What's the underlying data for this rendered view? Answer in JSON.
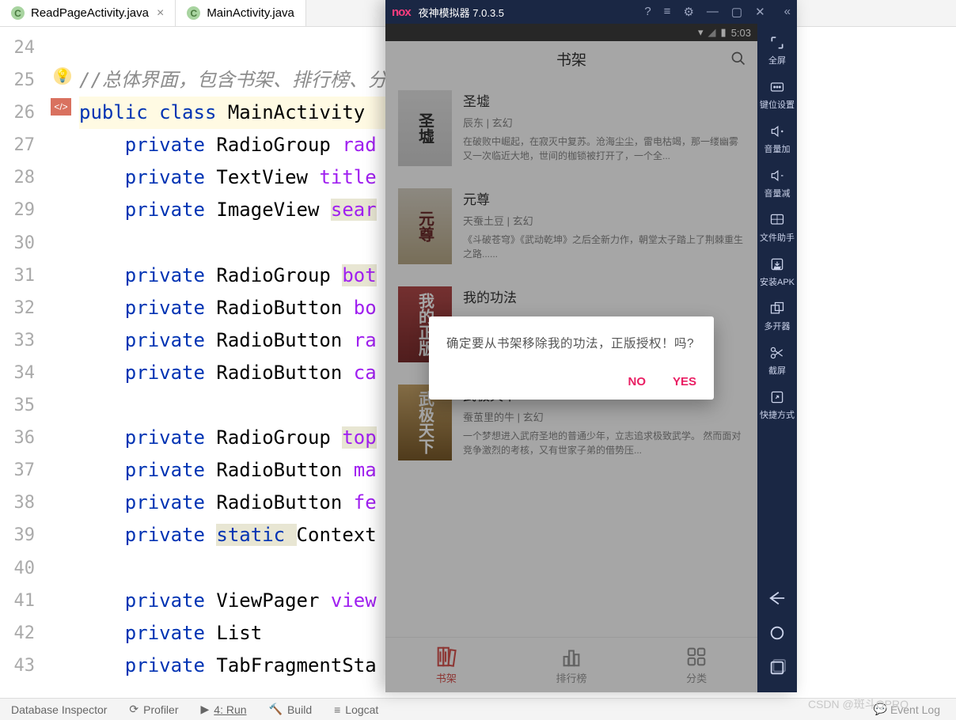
{
  "tabs": [
    {
      "label": "ReadPageActivity.java",
      "icon_letter": "C"
    },
    {
      "label": "MainActivity.java",
      "icon_letter": "C"
    }
  ],
  "gutter_lines": [
    "24",
    "25",
    "26",
    "27",
    "28",
    "29",
    "30",
    "31",
    "32",
    "33",
    "34",
    "35",
    "36",
    "37",
    "38",
    "39",
    "40",
    "41",
    "42",
    "43"
  ],
  "code_lines": [
    {
      "indent": 0,
      "tokens": []
    },
    {
      "indent": 0,
      "tokens": [
        {
          "t": "//",
          "cls": "cm"
        },
        {
          "t": "总体界面，包含书架、排行榜、分",
          "cls": "cm"
        }
      ]
    },
    {
      "indent": 0,
      "hl": true,
      "tokens": [
        {
          "t": "public ",
          "cls": "kw"
        },
        {
          "t": "class ",
          "cls": "kw"
        },
        {
          "t": "MainActivity ",
          "cls": "nm"
        }
      ]
    },
    {
      "indent": 1,
      "tokens": [
        {
          "t": "private ",
          "cls": "kw"
        },
        {
          "t": "RadioGroup ",
          "cls": "nm"
        },
        {
          "t": "rad",
          "cls": "fld"
        }
      ]
    },
    {
      "indent": 1,
      "tokens": [
        {
          "t": "private ",
          "cls": "kw"
        },
        {
          "t": "TextView ",
          "cls": "nm"
        },
        {
          "t": "title",
          "cls": "fld"
        }
      ]
    },
    {
      "indent": 1,
      "tokens": [
        {
          "t": "private ",
          "cls": "kw"
        },
        {
          "t": "ImageView ",
          "cls": "nm"
        },
        {
          "t": "sear",
          "cls": "fld hlw"
        }
      ]
    },
    {
      "indent": 0,
      "tokens": []
    },
    {
      "indent": 1,
      "tokens": [
        {
          "t": "private ",
          "cls": "kw"
        },
        {
          "t": "RadioGroup ",
          "cls": "nm"
        },
        {
          "t": "bot",
          "cls": "fld hlw"
        }
      ]
    },
    {
      "indent": 1,
      "tokens": [
        {
          "t": "private ",
          "cls": "kw"
        },
        {
          "t": "RadioButton ",
          "cls": "nm"
        },
        {
          "t": "bo",
          "cls": "fld"
        }
      ]
    },
    {
      "indent": 1,
      "tokens": [
        {
          "t": "private ",
          "cls": "kw"
        },
        {
          "t": "RadioButton ",
          "cls": "nm"
        },
        {
          "t": "ra",
          "cls": "fld"
        }
      ]
    },
    {
      "indent": 1,
      "tokens": [
        {
          "t": "private ",
          "cls": "kw"
        },
        {
          "t": "RadioButton ",
          "cls": "nm"
        },
        {
          "t": "ca",
          "cls": "fld"
        }
      ]
    },
    {
      "indent": 0,
      "tokens": []
    },
    {
      "indent": 1,
      "tokens": [
        {
          "t": "private ",
          "cls": "kw"
        },
        {
          "t": "RadioGroup ",
          "cls": "nm"
        },
        {
          "t": "top",
          "cls": "fld hlw"
        }
      ]
    },
    {
      "indent": 1,
      "tokens": [
        {
          "t": "private ",
          "cls": "kw"
        },
        {
          "t": "RadioButton ",
          "cls": "nm"
        },
        {
          "t": "ma",
          "cls": "fld"
        }
      ]
    },
    {
      "indent": 1,
      "tokens": [
        {
          "t": "private ",
          "cls": "kw"
        },
        {
          "t": "RadioButton ",
          "cls": "nm"
        },
        {
          "t": "fe",
          "cls": "fld"
        }
      ]
    },
    {
      "indent": 1,
      "tokens": [
        {
          "t": "private ",
          "cls": "kw"
        },
        {
          "t": "static ",
          "cls": "kw hlw"
        },
        {
          "t": "Context",
          "cls": "nm"
        }
      ]
    },
    {
      "indent": 0,
      "tokens": []
    },
    {
      "indent": 1,
      "tokens": [
        {
          "t": "private ",
          "cls": "kw"
        },
        {
          "t": "ViewPager ",
          "cls": "nm"
        },
        {
          "t": "view",
          "cls": "fld"
        }
      ]
    },
    {
      "indent": 1,
      "tokens": [
        {
          "t": "private ",
          "cls": "kw"
        },
        {
          "t": "List<Fragment>",
          "cls": "nm"
        }
      ]
    },
    {
      "indent": 1,
      "tokens": [
        {
          "t": "private ",
          "cls": "kw"
        },
        {
          "t": "TabFragmentSta",
          "cls": "nm"
        }
      ]
    }
  ],
  "bottom_bar": {
    "db_inspector": "Database Inspector",
    "profiler": "Profiler",
    "run": "4: Run",
    "build": "Build",
    "logcat": "Logcat",
    "event_log": "Event Log"
  },
  "watermark": "CSDN @斑斗QPRO",
  "emu": {
    "title": "夜神模拟器 7.0.3.5",
    "status_time": "5:03",
    "app_title": "书架",
    "books": [
      {
        "title": "圣墟",
        "author": "辰东",
        "genre": "玄幻",
        "desc": "在破败中崛起，在寂灭中复苏。沧海尘尘，雷电枯竭，那一缕幽雾又一次临近大地，世间的枷锁被打开了，一个全...",
        "cover": "圣墟"
      },
      {
        "title": "元尊",
        "author": "天蚕土豆",
        "genre": "玄幻",
        "desc": "《斗破苍穹》《武动乾坤》之后全新力作，朝堂太子踏上了荆棘重生之路......",
        "cover": "元尊"
      },
      {
        "title": "我的功法",
        "author": "",
        "genre": "",
        "desc": "",
        "cover": "我的正版"
      },
      {
        "title": "武极天下",
        "author": "蚕茧里的牛",
        "genre": "玄幻",
        "desc": "一个梦想进入武府圣地的普通少年，立志追求极致武学。  然而面对竞争激烈的考核，又有世家子弟的借势压...",
        "cover": "武极天下"
      }
    ],
    "dialog": {
      "message": "确定要从书架移除我的功法，正版授权！吗?",
      "no": "NO",
      "yes": "YES"
    },
    "nav": [
      {
        "label": "书架",
        "active": true
      },
      {
        "label": "排行榜",
        "active": false
      },
      {
        "label": "分类",
        "active": false
      }
    ],
    "sidebar": [
      {
        "label": "全屏",
        "icon": "fullscreen-icon"
      },
      {
        "label": "键位设置",
        "icon": "keymap-icon"
      },
      {
        "label": "音量加",
        "icon": "volume-up-icon"
      },
      {
        "label": "音量减",
        "icon": "volume-down-icon"
      },
      {
        "label": "文件助手",
        "icon": "folder-icon"
      },
      {
        "label": "安装APK",
        "icon": "apk-icon"
      },
      {
        "label": "多开器",
        "icon": "multi-icon"
      },
      {
        "label": "截屏",
        "icon": "scissors-icon"
      },
      {
        "label": "快捷方式",
        "icon": "shortcut-icon"
      }
    ]
  }
}
